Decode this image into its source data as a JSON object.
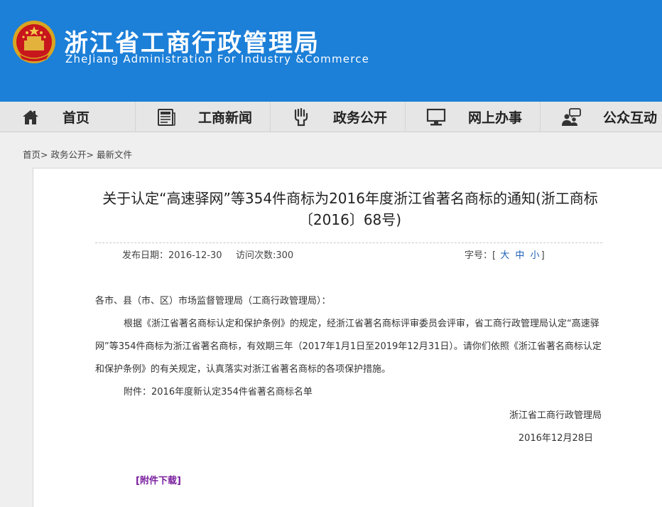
{
  "header": {
    "title": "浙江省工商行政管理局",
    "subtitle": "ZheJiang Administration For Industry &Commerce",
    "emblem_icon": "national-emblem-icon",
    "background_color": "#1c7fd8"
  },
  "nav": {
    "items": [
      {
        "label": "首页",
        "icon": "home-icon"
      },
      {
        "label": "工商新闻",
        "icon": "newspaper-icon"
      },
      {
        "label": "政务公开",
        "icon": "government-affairs-icon"
      },
      {
        "label": "网上办事",
        "icon": "computer-monitor-icon"
      },
      {
        "label": "公众互动",
        "icon": "people-chat-icon"
      }
    ]
  },
  "breadcrumb": {
    "items": [
      "首页",
      "政务公开",
      "最新文件"
    ],
    "separator": ">"
  },
  "article": {
    "title": "关于认定“高速驿网”等354件商标为2016年度浙江省著名商标的通知(浙工商标〔2016〕68号)",
    "publish_date": "发布日期：2016-12-30",
    "visit_count": "访问次数:300",
    "font_size_label": "字号：",
    "font_sizes": [
      "大",
      "中",
      "小"
    ],
    "salutation": "各市、县（市、区）市场监督管理局（工商行政管理局）：",
    "body": "根据《浙江省著名商标认定和保护条例》的规定，经浙江省著名商标评审委员会评审，省工商行政管理局认定“高速驿网”等354件商标为浙江省著名商标，有效期三年（2017年1月1日至2019年12月31日）。请你们依照《浙江省著名商标认定和保护条例》的有关规定，认真落实对浙江省著名商标的各项保护措施。",
    "attachment": "附件：2016年度新认定354件省著名商标名单",
    "signature_org": "浙江省工商行政管理局",
    "signature_date": "2016年12月28日",
    "download_label": "[附件下载]"
  },
  "colors": {
    "header_blue": "#1c7fd8",
    "nav_bg": "#e6e6e6",
    "link_purple": "#7a1f9e",
    "font_size_blue": "#1c5fb8"
  }
}
